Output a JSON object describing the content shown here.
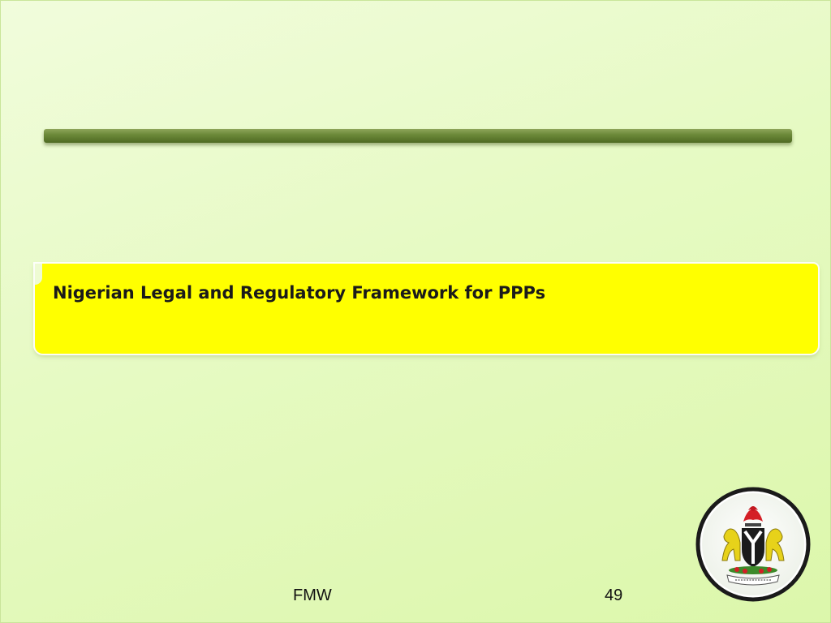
{
  "slide": {
    "title": "Nigerian Legal and Regulatory Framework for PPPs",
    "footer_left": "FMW",
    "page_number": "49"
  },
  "logo": {
    "icon": "coat-of-arms-icon"
  },
  "colors": {
    "background": "#e6fac3",
    "title_box": "#ffff00",
    "rule_bar": "#6d8a3a"
  }
}
